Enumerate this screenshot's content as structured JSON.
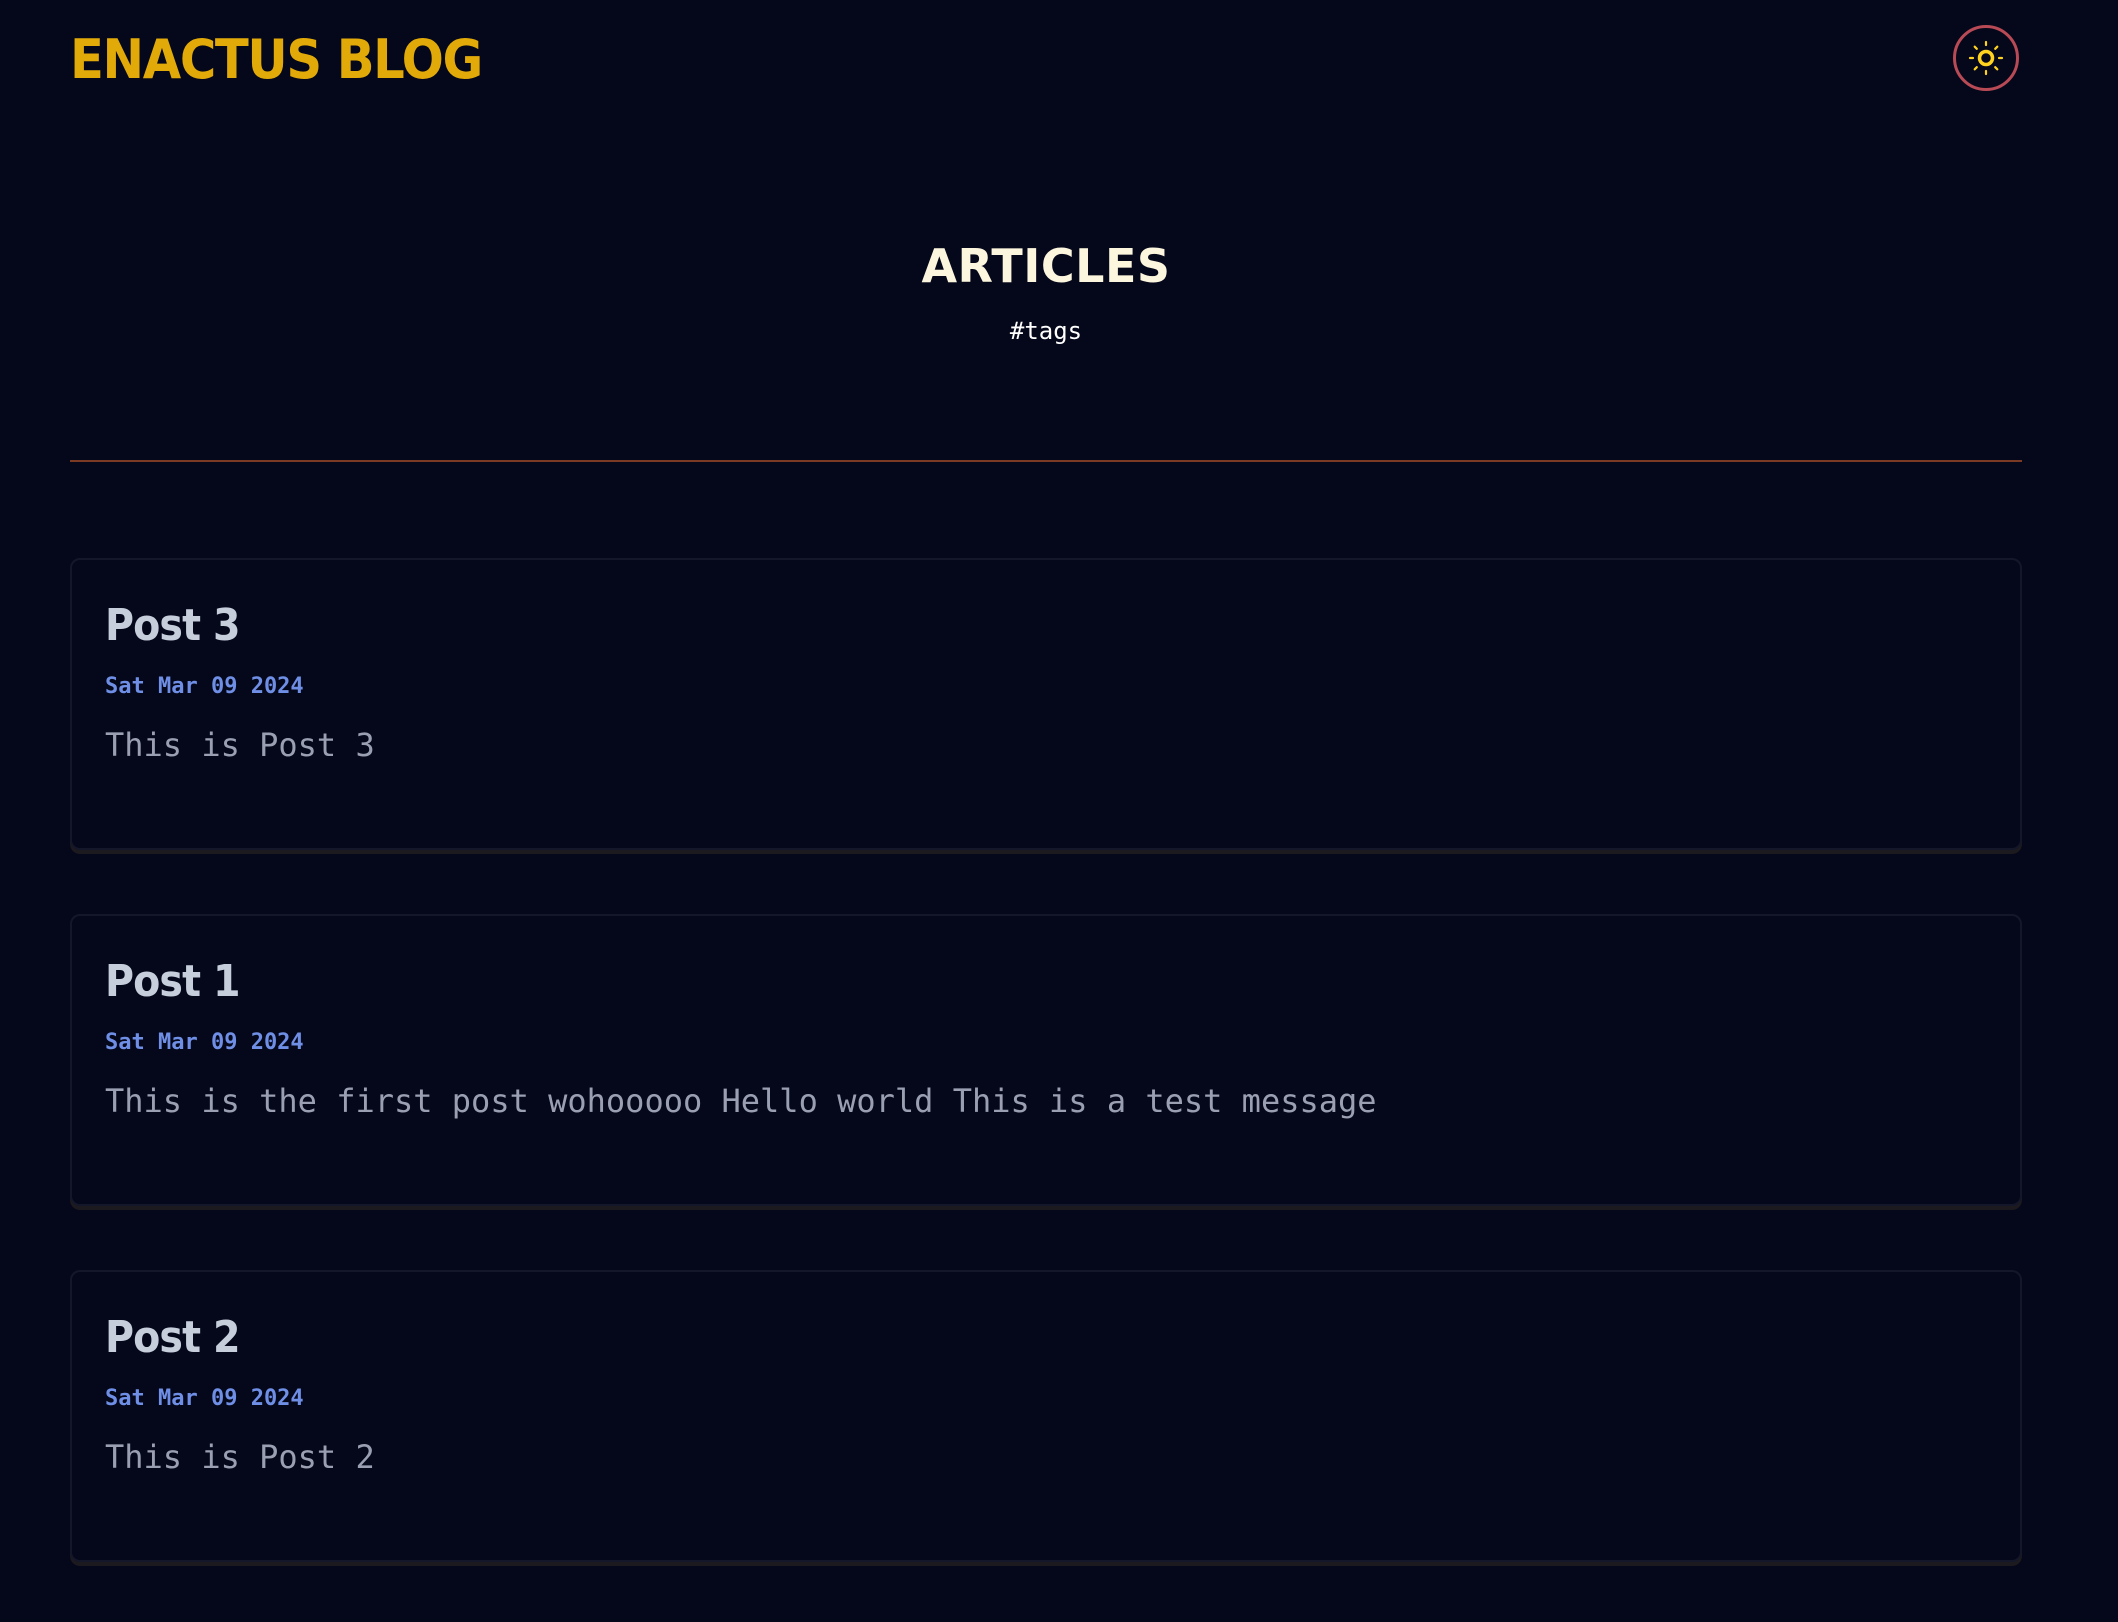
{
  "header": {
    "site_title": "ENACTUS BLOG",
    "theme_toggle_icon": "sun-icon",
    "theme_toggle_border_color": "#b84a55",
    "theme_toggle_icon_color": "#ffd21f"
  },
  "main": {
    "heading": "ARTICLES",
    "tags_link": "#tags",
    "posts": [
      {
        "title": "Post 3",
        "date": "Sat Mar 09 2024",
        "excerpt": "This is Post 3"
      },
      {
        "title": "Post 1",
        "date": "Sat Mar 09 2024",
        "excerpt": "This is the first post wohooooo Hello world This is a test message"
      },
      {
        "title": "Post 2",
        "date": "Sat Mar 09 2024",
        "excerpt": "This is Post 2"
      }
    ]
  },
  "colors": {
    "background": "#05071a",
    "brand": "#e2aa08",
    "heading": "#fdf6de",
    "post_title": "#c6cedc",
    "date": "#6f8fe6",
    "excerpt": "#9aa0b2",
    "divider": "#7a3a24"
  }
}
